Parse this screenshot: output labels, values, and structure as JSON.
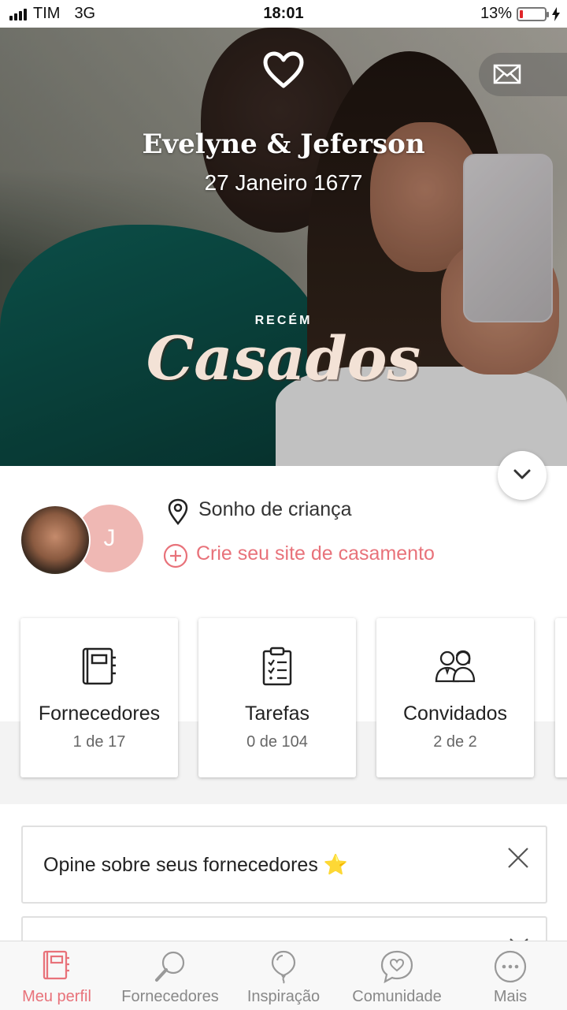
{
  "status_bar": {
    "carrier": "TIM",
    "network": "3G",
    "time": "18:01",
    "battery_percent": "13%",
    "battery_level": 0.13
  },
  "hero": {
    "couple_names": "Evelyne & Jeferson",
    "wedding_date": "27 Janeiro 1677",
    "badge_top": "RECÉM",
    "badge_main": "Casados",
    "icons": [
      "heart-icon",
      "mail-icon",
      "chevron-down-icon"
    ]
  },
  "profile": {
    "avatar_initial": "J",
    "location": "Sonho de criança",
    "create_site_label": "Crie seu site de casamento",
    "accent_color": "#e8727a"
  },
  "cards": [
    {
      "title": "Fornecedores",
      "count": "1 de 17",
      "icon": "notebook-icon"
    },
    {
      "title": "Tarefas",
      "count": "0 de 104",
      "icon": "checklist-icon"
    },
    {
      "title": "Convidados",
      "count": "2 de 2",
      "icon": "guests-icon"
    }
  ],
  "review_prompt": {
    "text": "Opine sobre seus fornecedores ⭐"
  },
  "bottom_nav": [
    {
      "label": "Meu perfil",
      "active": true,
      "icon": "notebook-icon"
    },
    {
      "label": "Fornecedores",
      "active": false,
      "icon": "search-icon"
    },
    {
      "label": "Inspiração",
      "active": false,
      "icon": "balloon-icon"
    },
    {
      "label": "Comunidade",
      "active": false,
      "icon": "chat-heart-icon"
    },
    {
      "label": "Mais",
      "active": false,
      "icon": "more-icon"
    }
  ]
}
